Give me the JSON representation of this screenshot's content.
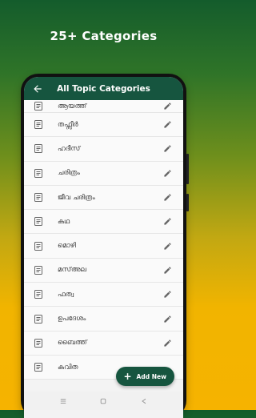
{
  "promo": {
    "headline": "25+ Categories"
  },
  "app_bar": {
    "title": "All Topic Categories"
  },
  "categories": [
    {
      "label": "ആയത്ത്"
    },
    {
      "label": "തഫ്സീർ"
    },
    {
      "label": "ഹദീസ്"
    },
    {
      "label": "ചരിത്രം"
    },
    {
      "label": "ജീവ ചരിത്രം"
    },
    {
      "label": "കഥ"
    },
    {
      "label": "മൊഴി"
    },
    {
      "label": "മസ്അല"
    },
    {
      "label": "ഫത്വ"
    },
    {
      "label": "ഉപദേശം"
    },
    {
      "label": "ബൈത്ത്"
    },
    {
      "label": "കവിത"
    }
  ],
  "fab": {
    "label": "Add New"
  },
  "icons": {
    "back": "arrow-back-icon",
    "row": "document-icon",
    "edit": "pencil-icon",
    "nav": [
      "menu-icon",
      "home-square-icon",
      "back-triangle-icon"
    ]
  },
  "colors": {
    "primary": "#16553f",
    "gradient_top": "#145c2c",
    "gradient_bottom": "#f6b300"
  }
}
